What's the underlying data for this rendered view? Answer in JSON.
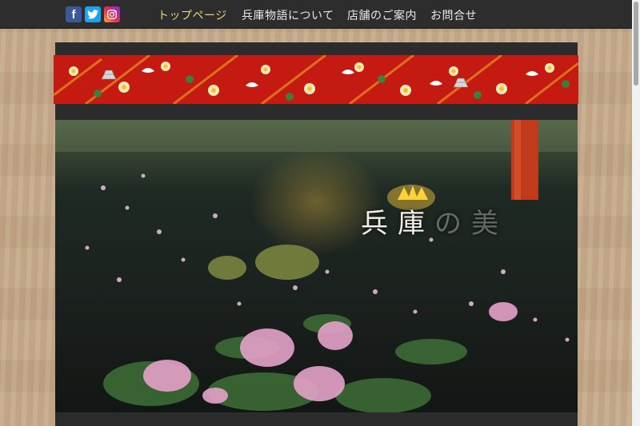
{
  "social": {
    "facebook": {
      "icon": "facebook-icon",
      "glyph": "f",
      "color": "#3b5998"
    },
    "twitter": {
      "icon": "twitter-icon",
      "glyph": "t",
      "color": "#1da1f2"
    },
    "instagram": {
      "icon": "instagram-icon",
      "glyph": "◎",
      "color": "#e0334e"
    }
  },
  "nav": {
    "items": [
      {
        "label": "トップページ",
        "active": true
      },
      {
        "label": "兵庫物語について",
        "active": false
      },
      {
        "label": "店舗のご案内",
        "active": false
      },
      {
        "label": "お問合せ",
        "active": false
      }
    ]
  },
  "hero": {
    "title_main": "兵庫",
    "title_faded": "の美"
  },
  "colors": {
    "topbar": "#2d2d2d",
    "nav_active": "#e8d27a",
    "banner_red": "#c41a12",
    "card": "#2c2c2c"
  }
}
